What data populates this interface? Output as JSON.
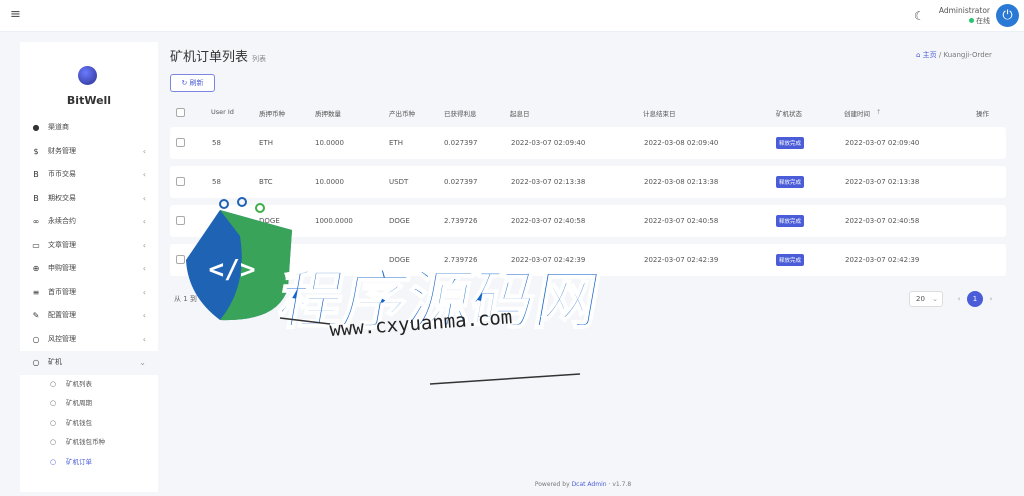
{
  "topbar": {
    "user_name": "Administrator",
    "user_status": "在线"
  },
  "sidebar": {
    "brand": "BitWell",
    "items": [
      {
        "label": "渠道商",
        "icon": "user-circle-icon",
        "glyph": "●",
        "arrow": ""
      },
      {
        "label": "财务管理",
        "icon": "dollar-icon",
        "glyph": "$",
        "arrow": "‹"
      },
      {
        "label": "币币交易",
        "icon": "bitcoin-icon",
        "glyph": "B",
        "arrow": "‹"
      },
      {
        "label": "期权交易",
        "icon": "bitcoin-icon",
        "glyph": "B",
        "arrow": "‹"
      },
      {
        "label": "永续合约",
        "icon": "link-icon",
        "glyph": "∞",
        "arrow": "‹"
      },
      {
        "label": "文章管理",
        "icon": "keyboard-icon",
        "glyph": "▭",
        "arrow": "‹"
      },
      {
        "label": "申购管理",
        "icon": "lifebuoy-icon",
        "glyph": "⊕",
        "arrow": "‹"
      },
      {
        "label": "首币管理",
        "icon": "list-icon",
        "glyph": "≡",
        "arrow": "‹"
      },
      {
        "label": "配置管理",
        "icon": "wrench-icon",
        "glyph": "✎",
        "arrow": "‹"
      },
      {
        "label": "风控管理",
        "icon": "circle-icon",
        "glyph": "○",
        "arrow": "‹"
      },
      {
        "label": "矿机",
        "icon": "circle-icon",
        "glyph": "○",
        "arrow": "⌄"
      }
    ],
    "subitems": [
      {
        "label": "矿机列表"
      },
      {
        "label": "矿机周期"
      },
      {
        "label": "矿机钱包"
      },
      {
        "label": "矿机钱包币种"
      },
      {
        "label": "矿机订单"
      }
    ]
  },
  "page": {
    "title": "矿机订单列表",
    "subtitle": "列表",
    "breadcrumb_home": "主页",
    "breadcrumb_sep": "/",
    "breadcrumb_current": "Kuangji-Order",
    "refresh_label": "刷新"
  },
  "table": {
    "headers": [
      "User Id",
      "质押币种",
      "质押数量",
      "产出币种",
      "已获得利息",
      "起息日",
      "计息结束日",
      "矿机状态",
      "创建时间",
      "操作"
    ],
    "sort_glyph": "↑",
    "rows": [
      {
        "user_id": "58",
        "pledge_coin": "ETH",
        "pledge_amount": "10.0000",
        "output_coin": "ETH",
        "interest": "0.027397",
        "start": "2022-03-07 02:09:40",
        "end": "2022-03-08 02:09:40",
        "status": "释放完成",
        "created": "2022-03-07 02:09:40"
      },
      {
        "user_id": "58",
        "pledge_coin": "BTC",
        "pledge_amount": "10.0000",
        "output_coin": "USDT",
        "interest": "0.027397",
        "start": "2022-03-07 02:13:38",
        "end": "2022-03-08 02:13:38",
        "status": "释放完成",
        "created": "2022-03-07 02:13:38"
      },
      {
        "user_id": "",
        "pledge_coin": "DOGE",
        "pledge_amount": "1000.0000",
        "output_coin": "DOGE",
        "interest": "2.739726",
        "start": "2022-03-07 02:40:58",
        "end": "2022-03-07 02:40:58",
        "status": "释放完成",
        "created": "2022-03-07 02:40:58"
      },
      {
        "user_id": "",
        "pledge_coin": "",
        "pledge_amount": "",
        "output_coin": "DOGE",
        "interest": "2.739726",
        "start": "2022-03-07 02:42:39",
        "end": "2022-03-07 02:42:39",
        "status": "释放完成",
        "created": "2022-03-07 02:42:39"
      }
    ]
  },
  "pagination": {
    "summary": "从 1 到",
    "per_page": "20",
    "prev": "‹",
    "current": "1",
    "next": "›"
  },
  "footer": {
    "prefix": "Powered by",
    "brand": "Dcat Admin",
    "sep": "·",
    "version": "v1.7.8"
  },
  "watermark": {
    "main_text": "程序源码网",
    "url": "www.cxyuanma.com",
    "code_glyph": "</>"
  }
}
